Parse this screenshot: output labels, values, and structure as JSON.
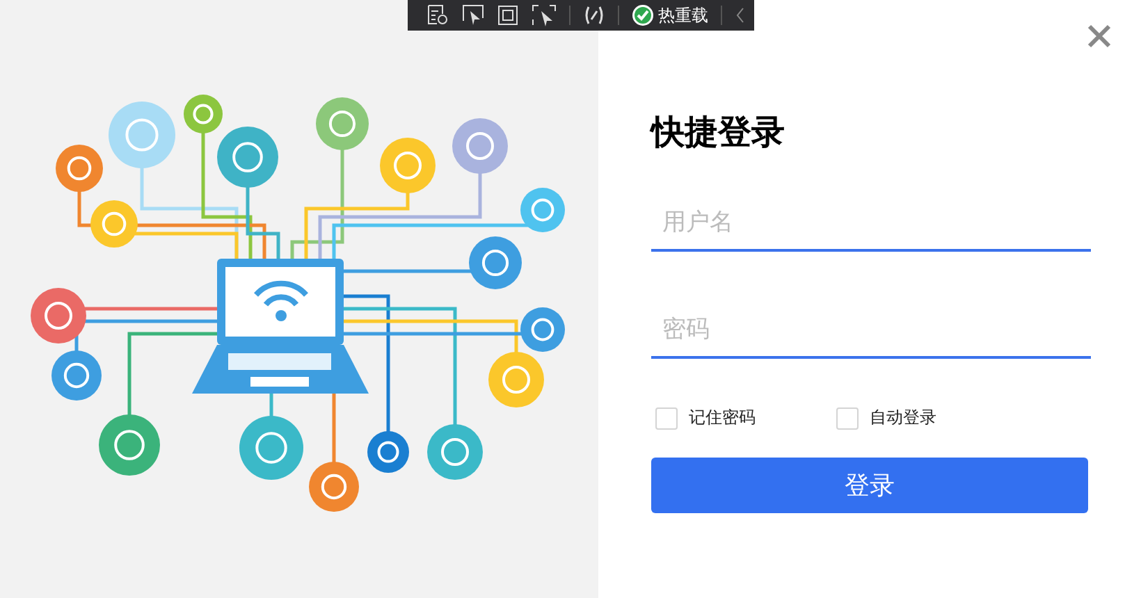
{
  "dev_toolbar": {
    "hot_reload_label": "热重载"
  },
  "login": {
    "title": "快捷登录",
    "fields": [
      {
        "placeholder": "用户名"
      },
      {
        "placeholder": "密码"
      }
    ],
    "options": [
      {
        "label": "记住密码",
        "checked": false
      },
      {
        "label": "自动登录",
        "checked": false
      }
    ],
    "submit_label": "登录"
  }
}
